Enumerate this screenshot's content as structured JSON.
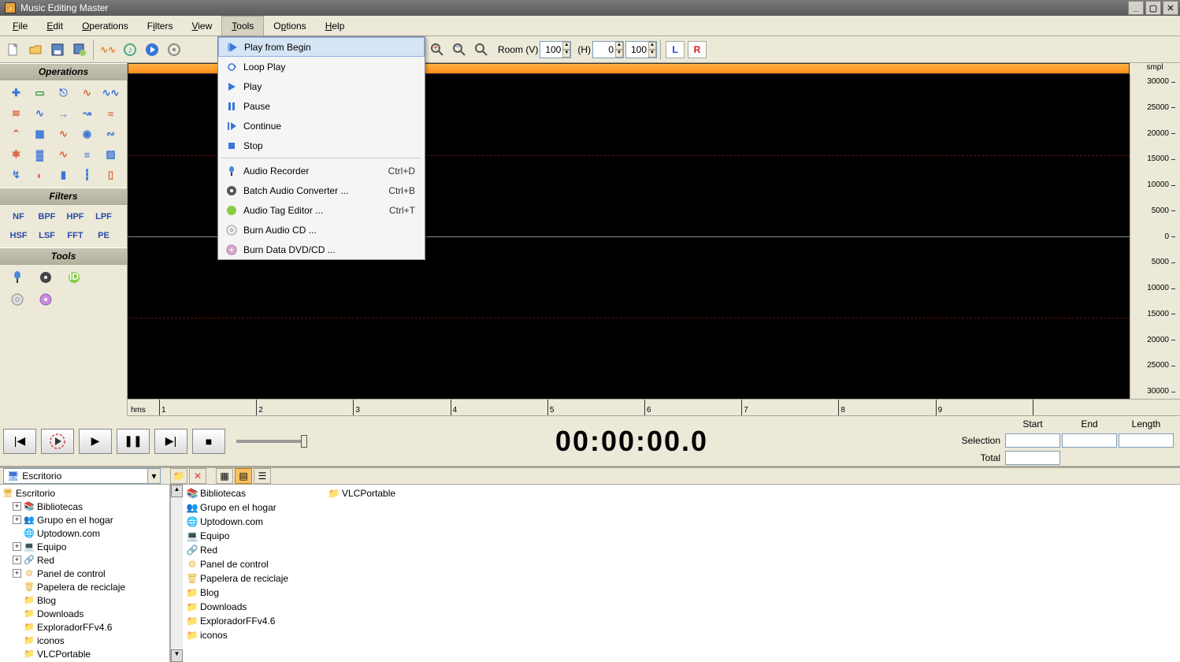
{
  "app": {
    "title": "Music Editing Master"
  },
  "menu": {
    "items": [
      "File",
      "Edit",
      "Operations",
      "Filters",
      "View",
      "Tools",
      "Options",
      "Help"
    ],
    "active_index": 5
  },
  "tools_dropdown": [
    {
      "label": "Play from Begin",
      "shortcut": "",
      "icon": "play-begin",
      "highlight": true
    },
    {
      "label": "Loop Play",
      "shortcut": "",
      "icon": "loop"
    },
    {
      "label": "Play",
      "shortcut": "",
      "icon": "play"
    },
    {
      "label": "Pause",
      "shortcut": "",
      "icon": "pause"
    },
    {
      "label": "Continue",
      "shortcut": "",
      "icon": "continue"
    },
    {
      "label": "Stop",
      "shortcut": "",
      "icon": "stop"
    },
    {
      "sep": true
    },
    {
      "label": "Audio Recorder",
      "shortcut": "Ctrl+D",
      "icon": "mic"
    },
    {
      "label": "Batch Audio Converter ...",
      "shortcut": "Ctrl+B",
      "icon": "batch"
    },
    {
      "label": "Audio Tag Editor ...",
      "shortcut": "Ctrl+T",
      "icon": "tag"
    },
    {
      "label": "Burn Audio CD ...",
      "shortcut": "",
      "icon": "cd"
    },
    {
      "label": "Burn Data DVD/CD ...",
      "shortcut": "",
      "icon": "dvd"
    }
  ],
  "toolbar": {
    "room_v_label": "Room (V)",
    "room_v_value": "100",
    "room_h_label": "(H)",
    "room_h_value1": "0",
    "room_h_value2": "100",
    "L": "L",
    "R": "R"
  },
  "sidebar": {
    "operations_title": "Operations",
    "filters_title": "Filters",
    "tools_title": "Tools",
    "filter_labels": [
      "NF",
      "BPF",
      "HPF",
      "LPF",
      "HSF",
      "LSF",
      "FFT",
      "PE"
    ]
  },
  "wave": {
    "ruler_unit": "smpl",
    "rticks": [
      "30000",
      "25000",
      "20000",
      "15000",
      "10000",
      "5000",
      "0",
      "5000",
      "10000",
      "15000",
      "20000",
      "25000",
      "30000"
    ],
    "time_label": "hms",
    "tmarks": [
      "1",
      "2",
      "3",
      "4",
      "5",
      "6",
      "7",
      "8",
      "9"
    ]
  },
  "transport": {
    "time": "00:00:00.0"
  },
  "selection": {
    "hdr_start": "Start",
    "hdr_end": "End",
    "hdr_length": "Length",
    "row1_label": "Selection",
    "row2_label": "Total"
  },
  "filebrowser": {
    "combo_label": "Escritorio",
    "tree": [
      {
        "level": 0,
        "expand": "",
        "icon": "desktop",
        "label": "Escritorio"
      },
      {
        "level": 1,
        "expand": "+",
        "icon": "lib",
        "label": "Bibliotecas"
      },
      {
        "level": 1,
        "expand": "+",
        "icon": "home",
        "label": "Grupo en el hogar"
      },
      {
        "level": 1,
        "expand": "",
        "icon": "web",
        "label": "Uptodown.com"
      },
      {
        "level": 1,
        "expand": "+",
        "icon": "computer",
        "label": "Equipo"
      },
      {
        "level": 1,
        "expand": "+",
        "icon": "net",
        "label": "Red"
      },
      {
        "level": 1,
        "expand": "+",
        "icon": "panel",
        "label": "Panel de control"
      },
      {
        "level": 1,
        "expand": "",
        "icon": "trash",
        "label": "Papelera de reciclaje"
      },
      {
        "level": 1,
        "expand": "",
        "icon": "folder",
        "label": "Blog"
      },
      {
        "level": 1,
        "expand": "",
        "icon": "folder",
        "label": "Downloads"
      },
      {
        "level": 1,
        "expand": "",
        "icon": "folder",
        "label": "ExploradorFFv4.6"
      },
      {
        "level": 1,
        "expand": "",
        "icon": "folder",
        "label": "iconos"
      },
      {
        "level": 1,
        "expand": "",
        "icon": "folder",
        "label": "VLCPortable"
      }
    ],
    "list_col1": [
      {
        "icon": "lib",
        "label": "Bibliotecas"
      },
      {
        "icon": "home",
        "label": "Grupo en el hogar"
      },
      {
        "icon": "web",
        "label": "Uptodown.com"
      },
      {
        "icon": "computer",
        "label": "Equipo"
      },
      {
        "icon": "net",
        "label": "Red"
      },
      {
        "icon": "panel",
        "label": "Panel de control"
      },
      {
        "icon": "trash",
        "label": "Papelera de reciclaje"
      },
      {
        "icon": "folder",
        "label": "Blog"
      },
      {
        "icon": "folder",
        "label": "Downloads"
      },
      {
        "icon": "folder",
        "label": "ExploradorFFv4.6"
      },
      {
        "icon": "folder",
        "label": "iconos"
      }
    ],
    "list_col2": [
      {
        "icon": "folder",
        "label": "VLCPortable"
      }
    ]
  }
}
